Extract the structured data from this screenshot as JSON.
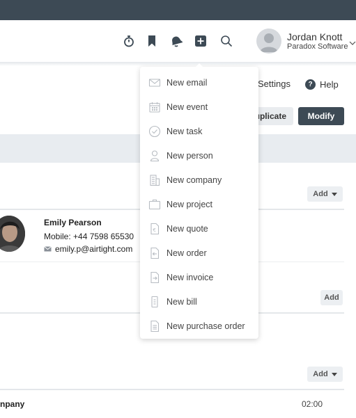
{
  "header": {
    "icons": [
      "stopwatch-icon",
      "bookmark-icon",
      "bell-icon",
      "add-icon",
      "search-icon"
    ],
    "user": {
      "name": "Jordan Knott",
      "company": "Paradox Software"
    }
  },
  "page": {
    "settings_label": "Settings",
    "help_label": "Help",
    "help_glyph": "?",
    "duplicate_label": "uplicate",
    "modify_label": "Modify",
    "add_label": "Add"
  },
  "contact": {
    "name": "Emily Pearson",
    "mobile": "Mobile: +44 7598 65530",
    "email": "emily.p@airtight.com"
  },
  "row": {
    "company": "npany",
    "time": "02:00"
  },
  "add_menu": {
    "items": [
      {
        "label": "New email",
        "icon": "email-icon"
      },
      {
        "label": "New event",
        "icon": "calendar-icon"
      },
      {
        "label": "New task",
        "icon": "check-circle-icon"
      },
      {
        "label": "New person",
        "icon": "person-icon"
      },
      {
        "label": "New company",
        "icon": "building-icon"
      },
      {
        "label": "New project",
        "icon": "briefcase-icon"
      },
      {
        "label": "New quote",
        "icon": "quote-document-icon"
      },
      {
        "label": "New order",
        "icon": "order-document-icon"
      },
      {
        "label": "New invoice",
        "icon": "invoice-document-icon"
      },
      {
        "label": "New bill",
        "icon": "bill-document-icon"
      },
      {
        "label": "New purchase order",
        "icon": "purchase-order-document-icon"
      }
    ]
  },
  "colors": {
    "topbar": "#3d4a55",
    "primary_button": "#3d4a55",
    "band": "#e8ecf0",
    "menu_icon": "#b7bcc2"
  }
}
